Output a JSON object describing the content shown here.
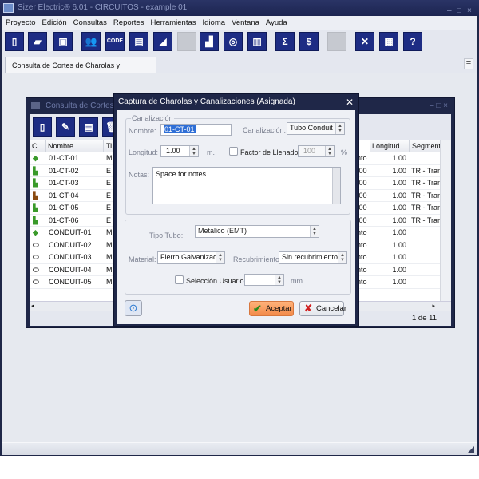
{
  "app": {
    "title": "Sizer Electric® 6.01 - CIRCUITOS - example 01",
    "window_controls": [
      "–",
      "□",
      "×"
    ]
  },
  "menu": [
    "Proyecto",
    "Edición",
    "Consultas",
    "Reportes",
    "Herramientas",
    "Idioma",
    "Ventana",
    "Ayuda"
  ],
  "toolbar": [
    {
      "icon": "new-document-icon",
      "glyph": "▯",
      "enabled": true
    },
    {
      "icon": "open-folder-icon",
      "glyph": "▰",
      "enabled": true
    },
    {
      "icon": "save-icon",
      "glyph": "▣",
      "enabled": true
    },
    {
      "icon": "users-icon",
      "glyph": "👥",
      "enabled": true
    },
    {
      "icon": "code-icon",
      "glyph": "CODE",
      "enabled": true
    },
    {
      "icon": "report-icon",
      "glyph": "▤",
      "enabled": true
    },
    {
      "icon": "eraser-icon",
      "glyph": "◢",
      "enabled": true
    },
    {
      "icon": "disabled-icon",
      "glyph": "",
      "enabled": false
    },
    {
      "icon": "chart-icon",
      "glyph": "▟",
      "enabled": true
    },
    {
      "icon": "rings-icon",
      "glyph": "◎",
      "enabled": true
    },
    {
      "icon": "library-icon",
      "glyph": "▥",
      "enabled": true
    },
    {
      "icon": "sum-icon",
      "glyph": "Σ",
      "enabled": true
    },
    {
      "icon": "cost-icon",
      "glyph": "$",
      "enabled": true
    },
    {
      "icon": "disabled-icon",
      "glyph": "",
      "enabled": false
    },
    {
      "icon": "close-tools-icon",
      "glyph": "✕",
      "enabled": true
    },
    {
      "icon": "calculator-icon",
      "glyph": "▦",
      "enabled": true
    },
    {
      "icon": "help-icon",
      "glyph": "?",
      "enabled": true
    }
  ],
  "tab": {
    "label": "Consulta de Cortes de Charolas y Canalizaciones",
    "menu_glyph": "≡"
  },
  "child": {
    "title": "Consulta de Cortes de Charolas y Canalizaciones",
    "columns": {
      "c": "C",
      "nombre": "Nombre",
      "tipo": "Ti",
      "longitud": "Longitud",
      "segmento": "Segmento"
    },
    "rows": [
      {
        "icon": "conduit-check-icon",
        "color": "#3a9a2a",
        "nombre": "01-CT-01",
        "tipo": "M",
        "hidden": "nto",
        "longitud": "1.00",
        "segmento": ""
      },
      {
        "icon": "tray-icon",
        "color": "#3a9a2a",
        "nombre": "01-CT-02",
        "tipo": "E",
        "hidden": ".00",
        "longitud": "1.00",
        "segmento": "TR - Tram"
      },
      {
        "icon": "tray-icon",
        "color": "#3a9a2a",
        "nombre": "01-CT-03",
        "tipo": "E",
        "hidden": ".00",
        "longitud": "1.00",
        "segmento": "TR - Tram"
      },
      {
        "icon": "tray-icon",
        "color": "#8a4a10",
        "nombre": "01-CT-04",
        "tipo": "E",
        "hidden": ".00",
        "longitud": "1.00",
        "segmento": "TR - Tram"
      },
      {
        "icon": "tray-icon",
        "color": "#3a9a2a",
        "nombre": "01-CT-05",
        "tipo": "E",
        "hidden": ".00",
        "longitud": "1.00",
        "segmento": "TR - Tram"
      },
      {
        "icon": "tray-icon",
        "color": "#3a9a2a",
        "nombre": "01-CT-06",
        "tipo": "E",
        "hidden": ".00",
        "longitud": "1.00",
        "segmento": "TR - Tram"
      },
      {
        "icon": "conduit-check-icon",
        "color": "#3a9a2a",
        "nombre": "CONDUIT-01",
        "tipo": "M",
        "hidden": "nto",
        "longitud": "1.00",
        "segmento": ""
      },
      {
        "icon": "pipe-icon",
        "color": "#333",
        "nombre": "CONDUIT-02",
        "tipo": "M",
        "hidden": "nto",
        "longitud": "1.00",
        "segmento": ""
      },
      {
        "icon": "pipe-icon",
        "color": "#333",
        "nombre": "CONDUIT-03",
        "tipo": "M",
        "hidden": "nto",
        "longitud": "1.00",
        "segmento": ""
      },
      {
        "icon": "pipe-icon",
        "color": "#333",
        "nombre": "CONDUIT-04",
        "tipo": "M",
        "hidden": "nto",
        "longitud": "1.00",
        "segmento": ""
      },
      {
        "icon": "pipe-icon",
        "color": "#333",
        "nombre": "CONDUIT-05",
        "tipo": "M",
        "hidden": "nto",
        "longitud": "1.00",
        "segmento": ""
      }
    ],
    "pager": "1 de 11"
  },
  "dialog": {
    "title": "Captura de Charolas y Canalizaciones (Asignada)",
    "group1": "Canalización",
    "nombre_label": "Nombre:",
    "nombre_value": "01-CT-01",
    "canalizacion_label": "Canalización:",
    "canalizacion_value": "Tubo Conduit",
    "longitud_label": "Longitud:",
    "longitud_value": "1.00",
    "longitud_unit": "m.",
    "factor_label": "Factor de Llenado:",
    "factor_checked": false,
    "factor_value": "100",
    "factor_unit": "%",
    "notas_label": "Notas:",
    "notas_value": "Space for notes",
    "tipo_tubo_label": "Tipo Tubo:",
    "tipo_tubo_value": "Metálico (EMT)",
    "material_label": "Material:",
    "material_value": "Fierro Galvanizado",
    "recubrimiento_label": "Recubrimiento:",
    "recubrimiento_value": "Sin recubrimiento",
    "seleccion_label": "Selección Usuario:",
    "seleccion_checked": false,
    "seleccion_value": "",
    "seleccion_unit": "mm",
    "accept": "Aceptar",
    "cancel": "Cancelar"
  }
}
